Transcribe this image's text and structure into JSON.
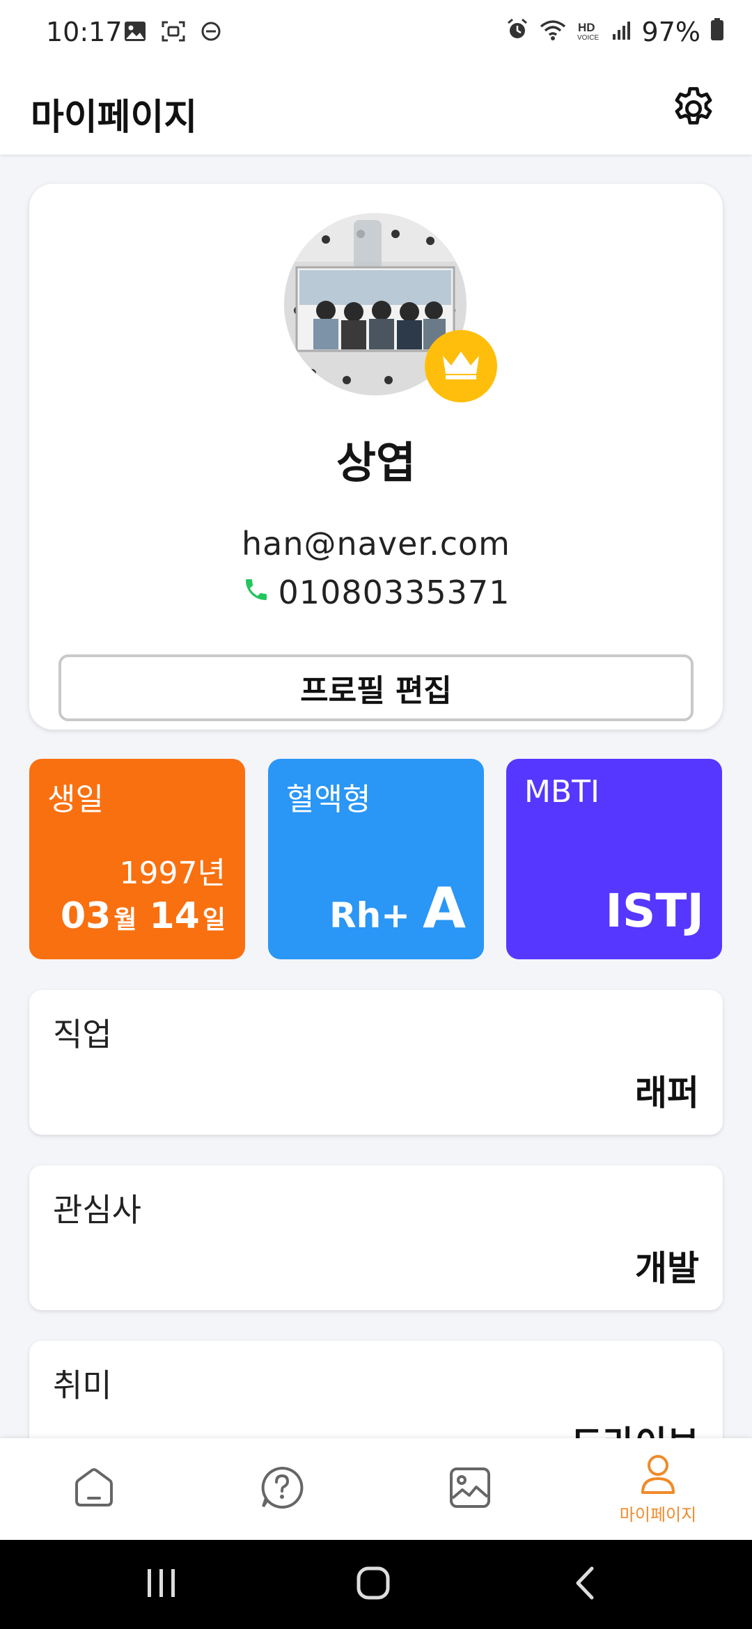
{
  "status_bar": {
    "time": "10:17",
    "battery": "97%",
    "left_icons": [
      "gallery-icon",
      "screenshot-icon",
      "do-not-disturb-icon"
    ],
    "right_icons": [
      "alarm-icon",
      "wifi-icon",
      "hd-voice-icon",
      "signal-icon",
      "battery-icon"
    ]
  },
  "header": {
    "title": "마이페이지",
    "settings_icon": "gear-icon"
  },
  "profile": {
    "name": "상엽",
    "email": "han@naver.com",
    "phone": "01080335371",
    "edit_button": "프로필 편집",
    "badge_icon": "crown-icon"
  },
  "tiles": {
    "birthday": {
      "label": "생일",
      "year": "1997년",
      "month": "03",
      "month_unit": "월",
      "day": "14",
      "day_unit": "일",
      "color": "#f97010"
    },
    "blood": {
      "label": "혈액형",
      "rh": "Rh+",
      "type": "A",
      "color": "#2a96f5"
    },
    "mbti": {
      "label": "MBTI",
      "value": "ISTJ",
      "color": "#5637ff"
    }
  },
  "details": [
    {
      "label": "직업",
      "value": "래퍼"
    },
    {
      "label": "관심사",
      "value": "개발"
    },
    {
      "label": "취미",
      "value": "드라이브"
    }
  ],
  "bottom_nav": {
    "items": [
      {
        "icon": "home-icon",
        "label": ""
      },
      {
        "icon": "question-icon",
        "label": ""
      },
      {
        "icon": "gallery-icon",
        "label": ""
      },
      {
        "icon": "person-icon",
        "label": "마이페이지"
      }
    ],
    "active_color": "#f08a2a"
  },
  "colors": {
    "background": "#f4f5f9",
    "crown_badge": "#ffbe0b",
    "phone_icon": "#22c55e"
  }
}
